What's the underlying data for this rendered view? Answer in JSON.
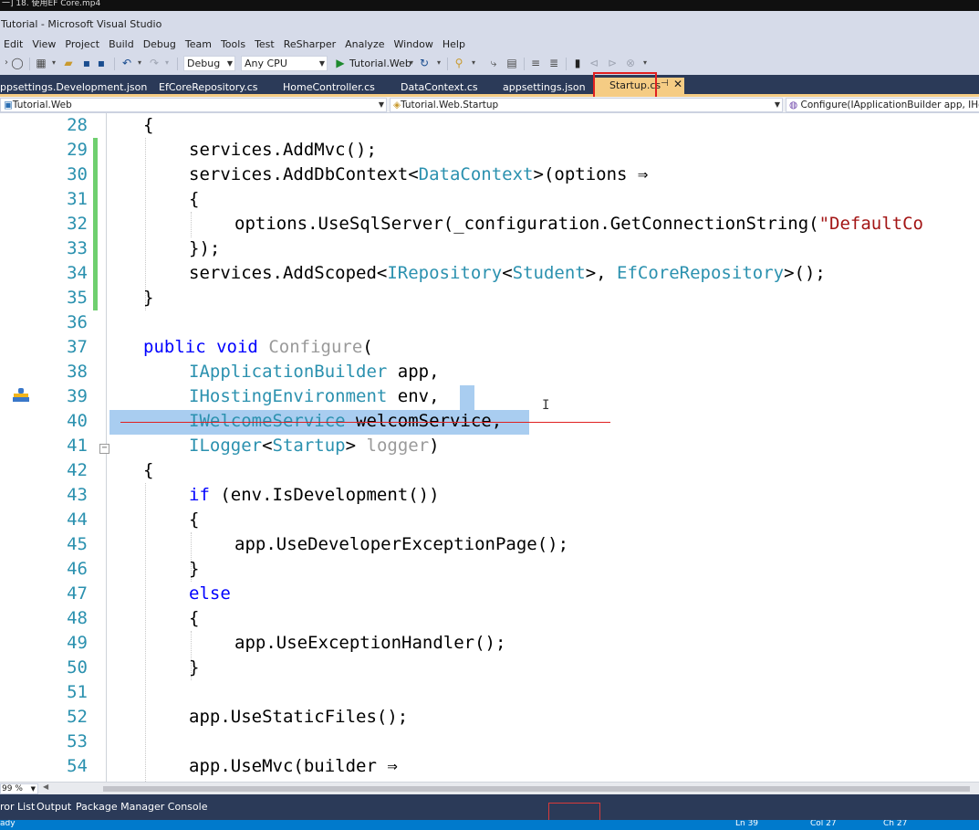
{
  "video_title": "一] 18. 使用EF Core.mp4",
  "window_title": "Tutorial - Microsoft Visual Studio",
  "menu": [
    "Edit",
    "View",
    "Project",
    "Build",
    "Debug",
    "Team",
    "Tools",
    "Test",
    "ReSharper",
    "Analyze",
    "Window",
    "Help"
  ],
  "toolbar": {
    "config": "Debug",
    "platform": "Any CPU",
    "start_target": "Tutorial.Web"
  },
  "tabs": [
    {
      "label": "ppsettings.Development.json"
    },
    {
      "label": "EfCoreRepository.cs"
    },
    {
      "label": "HomeController.cs"
    },
    {
      "label": "DataContext.cs"
    },
    {
      "label": "appsettings.json"
    },
    {
      "label": "Startup.cs",
      "active": true
    }
  ],
  "navbar": {
    "project": "Tutorial.Web",
    "class": "Tutorial.Web.Startup",
    "member": "Configure(IApplicationBuilder app, IHostin"
  },
  "code_lines": [
    {
      "num": "28",
      "indent": 0,
      "tokens": [
        [
          "p",
          "{"
        ]
      ]
    },
    {
      "num": "29",
      "indent": 1,
      "tokens": [
        [
          "p",
          "services.AddMvc();"
        ]
      ]
    },
    {
      "num": "30",
      "indent": 1,
      "tokens": [
        [
          "p",
          "services.AddDbContext<"
        ],
        [
          "ty",
          "DataContext"
        ],
        [
          "p",
          ">(options ⇒"
        ]
      ]
    },
    {
      "num": "31",
      "indent": 1,
      "tokens": [
        [
          "p",
          "{"
        ]
      ]
    },
    {
      "num": "32",
      "indent": 2,
      "tokens": [
        [
          "p",
          "options.UseSqlServer(_configuration.GetConnectionString("
        ],
        [
          "str",
          "\"DefaultCo"
        ]
      ]
    },
    {
      "num": "33",
      "indent": 1,
      "tokens": [
        [
          "p",
          "});"
        ]
      ]
    },
    {
      "num": "34",
      "indent": 1,
      "tokens": [
        [
          "p",
          "services.AddScoped<"
        ],
        [
          "ty",
          "IRepository"
        ],
        [
          "p",
          "<"
        ],
        [
          "ty",
          "Student"
        ],
        [
          "p",
          ">, "
        ],
        [
          "ty",
          "EfCoreRepository"
        ],
        [
          "p",
          ">();"
        ]
      ]
    },
    {
      "num": "35",
      "indent": 0,
      "tokens": [
        [
          "p",
          "}"
        ]
      ]
    },
    {
      "num": "36",
      "indent": 0,
      "tokens": []
    },
    {
      "num": "37",
      "indent": 0,
      "tokens": [
        [
          "kw",
          "public"
        ],
        [
          "p",
          " "
        ],
        [
          "kw",
          "void"
        ],
        [
          "p",
          " "
        ],
        [
          "dim",
          "Configure"
        ],
        [
          "p",
          "("
        ]
      ]
    },
    {
      "num": "38",
      "indent": 1,
      "tokens": [
        [
          "ty",
          "IApplicationBuilder"
        ],
        [
          "p",
          " app,"
        ]
      ]
    },
    {
      "num": "39",
      "indent": 1,
      "tokens": [
        [
          "ty",
          "IHostingEnvironment"
        ],
        [
          "p",
          " env,"
        ]
      ]
    },
    {
      "num": "40",
      "indent": 1,
      "tokens": [
        [
          "ty",
          "IWelcomeService"
        ],
        [
          "p",
          " welcomService,"
        ]
      ]
    },
    {
      "num": "41",
      "indent": 1,
      "tokens": [
        [
          "ty",
          "ILogger"
        ],
        [
          "p",
          "<"
        ],
        [
          "ty",
          "Startup"
        ],
        [
          "p",
          "> "
        ],
        [
          "dim",
          "logger"
        ],
        [
          "p",
          ")"
        ]
      ]
    },
    {
      "num": "42",
      "indent": 0,
      "tokens": [
        [
          "p",
          "{"
        ]
      ]
    },
    {
      "num": "43",
      "indent": 1,
      "tokens": [
        [
          "kw",
          "if"
        ],
        [
          "p",
          " (env.IsDevelopment())"
        ]
      ]
    },
    {
      "num": "44",
      "indent": 1,
      "tokens": [
        [
          "p",
          "{"
        ]
      ]
    },
    {
      "num": "45",
      "indent": 2,
      "tokens": [
        [
          "p",
          "app.UseDeveloperExceptionPage();"
        ]
      ]
    },
    {
      "num": "46",
      "indent": 1,
      "tokens": [
        [
          "p",
          "}"
        ]
      ]
    },
    {
      "num": "47",
      "indent": 1,
      "tokens": [
        [
          "kw",
          "else"
        ]
      ]
    },
    {
      "num": "48",
      "indent": 1,
      "tokens": [
        [
          "p",
          "{"
        ]
      ]
    },
    {
      "num": "49",
      "indent": 2,
      "tokens": [
        [
          "p",
          "app.UseExceptionHandler();"
        ]
      ]
    },
    {
      "num": "50",
      "indent": 1,
      "tokens": [
        [
          "p",
          "}"
        ]
      ]
    },
    {
      "num": "51",
      "indent": 0,
      "tokens": []
    },
    {
      "num": "52",
      "indent": 1,
      "tokens": [
        [
          "p",
          "app.UseStaticFiles();"
        ]
      ]
    },
    {
      "num": "53",
      "indent": 0,
      "tokens": []
    },
    {
      "num": "54",
      "indent": 1,
      "tokens": [
        [
          "p",
          "app.UseMvc(builder ⇒"
        ]
      ]
    }
  ],
  "zoom": "99 %",
  "panels": [
    "ror List",
    "Output",
    "Package Manager Console"
  ],
  "status": {
    "left": "ady",
    "ln": "Ln 39",
    "col": "Col 27",
    "ch": "Ch 27"
  },
  "colors": {
    "tab_bar": "#2b3a58",
    "active_tab": "#f5cc84",
    "status_bar": "#007acc",
    "keyword": "#0000ff",
    "type": "#2b91af",
    "string": "#a31515"
  }
}
